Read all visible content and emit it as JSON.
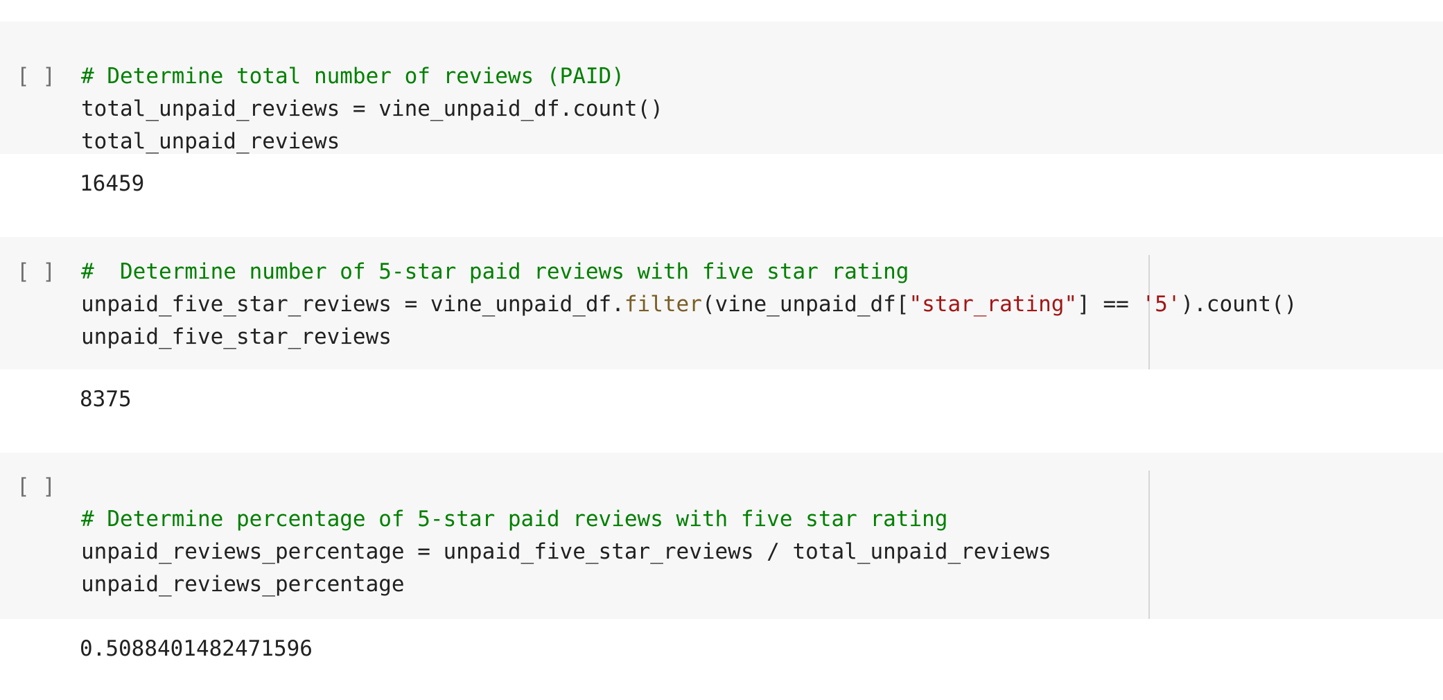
{
  "cells": [
    {
      "run_label": "[ ]",
      "lines": [
        {
          "comment": "# Determine total number of reviews (PAID)"
        },
        {
          "text": "total_unpaid_reviews = vine_unpaid_df.count()"
        },
        {
          "text": "total_unpaid_reviews"
        }
      ],
      "output": "16459"
    },
    {
      "run_label": "[ ]",
      "lines": [
        {
          "comment": "#  Determine number of 5-star paid reviews with five star rating"
        },
        {
          "p1": "unpaid_five_star_reviews = vine_unpaid_df.",
          "fn": "filter",
          "p2": "(vine_unpaid_df[",
          "s1": "\"star_rating\"",
          "p3": "] == ",
          "s2": "'5'",
          "p4": ").count()"
        },
        {
          "text": "unpaid_five_star_reviews"
        }
      ],
      "output": "8375"
    },
    {
      "run_label": "[ ]",
      "lines": [
        {
          "text": ""
        },
        {
          "comment": "# Determine percentage of 5-star paid reviews with five star rating"
        },
        {
          "text": "unpaid_reviews_percentage = unpaid_five_star_reviews / total_unpaid_reviews"
        },
        {
          "text": "unpaid_reviews_percentage"
        }
      ],
      "output": "0.5088401482471596"
    }
  ],
  "colors": {
    "comment": "#008000",
    "function": "#795e26",
    "string": "#a31515",
    "code": "#212121",
    "cell_background": "#f7f7f7"
  }
}
